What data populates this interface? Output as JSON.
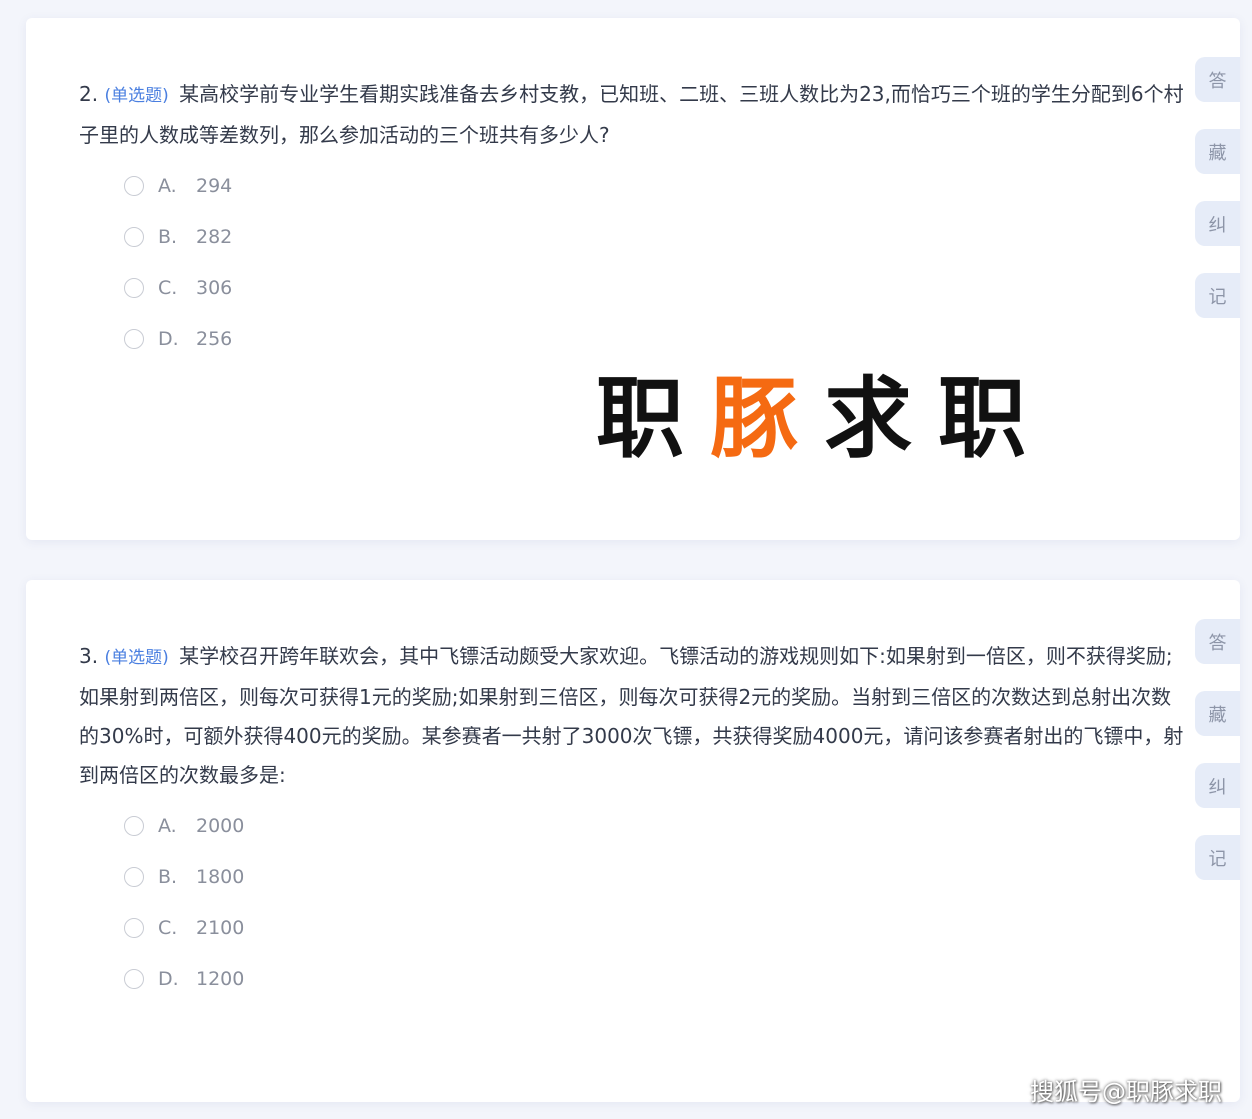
{
  "questions": [
    {
      "number": "2.",
      "type": "(单选题)",
      "text": "某高校学前专业学生看期实践准备去乡村支教，已知班、二班、三班人数比为23,而恰巧三个班的学生分配到6个村子里的人数成等差数列，那么参加活动的三个班共有多少人?",
      "options": [
        {
          "letter": "A.",
          "value": "294"
        },
        {
          "letter": "B.",
          "value": "282"
        },
        {
          "letter": "C.",
          "value": "306"
        },
        {
          "letter": "D.",
          "value": "256"
        }
      ],
      "tools": [
        "答",
        "藏",
        "纠",
        "记"
      ]
    },
    {
      "number": "3.",
      "type": "(单选题)",
      "text": "某学校召开跨年联欢会，其中飞镖活动颇受大家欢迎。飞镖活动的游戏规则如下:如果射到一倍区，则不获得奖励;如果射到两倍区，则每次可获得1元的奖励;如果射到三倍区，则每次可获得2元的奖励。当射到三倍区的次数达到总射出次数的30%时，可额外获得400元的奖励。某参赛者一共射了3000次飞镖，共获得奖励4000元，请问该参赛者射出的飞镖中，射到两倍区的次数最多是:",
      "options": [
        {
          "letter": "A.",
          "value": "2000"
        },
        {
          "letter": "B.",
          "value": "1800"
        },
        {
          "letter": "C.",
          "value": "2100"
        },
        {
          "letter": "D.",
          "value": "1200"
        }
      ],
      "tools": [
        "答",
        "藏",
        "纠",
        "记"
      ]
    }
  ],
  "logo": {
    "char1": "职",
    "char2": "豚",
    "char3": "求",
    "char4": "职",
    "accent_color": "#f56a12"
  },
  "watermark": "搜狐号@职豚求职"
}
